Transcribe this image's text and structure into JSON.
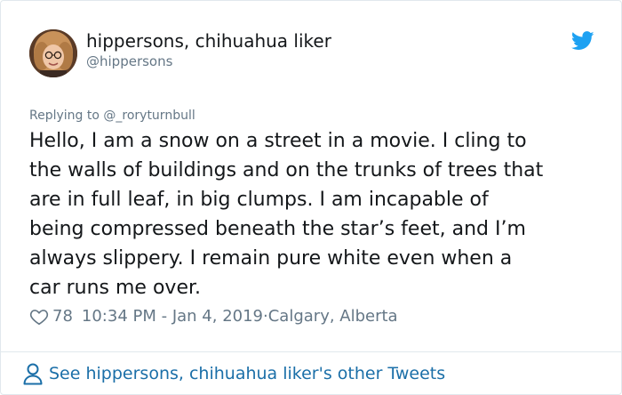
{
  "author": {
    "name": "hippersons, chihuahua liker",
    "handle": "@hippersons"
  },
  "reply_prefix": "Replying to ",
  "reply_to": "@_roryturnbull",
  "tweet_lines": [
    "Hello, I am a snow on a street in a movie. I cling to",
    "the walls of buildings and on the trunks of trees that",
    "are in full leaf, in big clumps. I am incapable of",
    "being compressed beneath the star’s feet, and I’m",
    "always slippery. I remain pure white even when a",
    "car runs me over."
  ],
  "likes": "78",
  "timestamp": "10:34 PM - Jan 4, 2019",
  "separator": " · ",
  "location": "Calgary, Alberta",
  "footer_link": "See hippersons, chihuahua liker's other Tweets",
  "colors": {
    "twitter_blue": "#1da1f2",
    "link_blue": "#1b6fa8",
    "meta_gray": "#657786",
    "text": "#14171a"
  },
  "icons": {
    "brand": "twitter-bird-icon",
    "like": "heart-icon",
    "footer": "person-icon"
  }
}
